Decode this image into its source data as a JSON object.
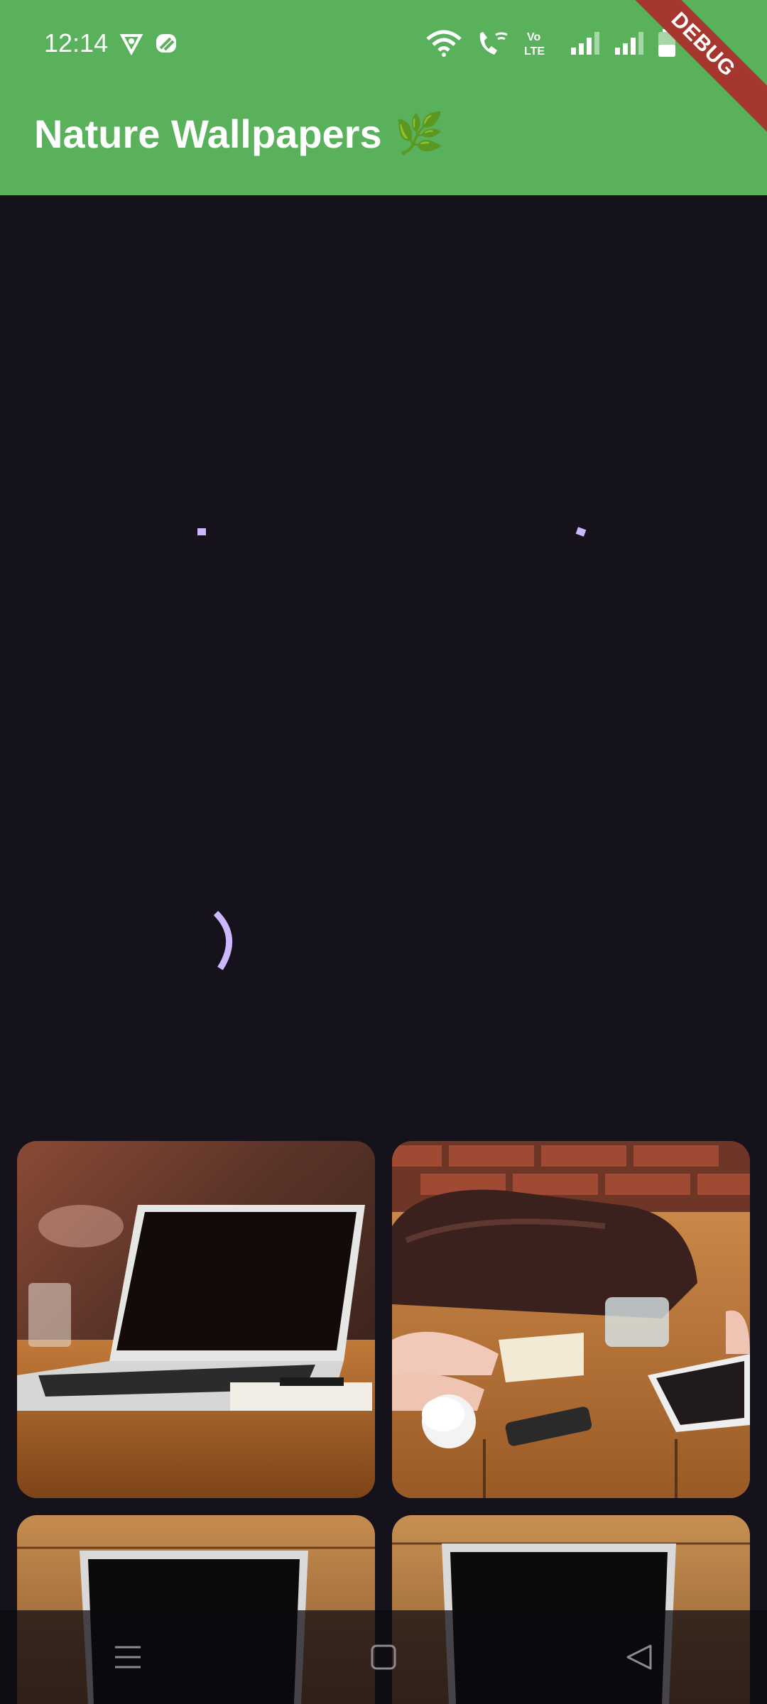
{
  "status_bar": {
    "time": "12:14",
    "battery": "32",
    "icons": [
      "vpn-shield-icon",
      "app-notification-icon",
      "wifi-icon",
      "wifi-call-icon",
      "volte-icon",
      "signal-icon",
      "signal-icon",
      "battery-icon"
    ]
  },
  "app_bar": {
    "title": "Nature Wallpapers",
    "emoji": "🌿"
  },
  "debug_banner": "DEBUG",
  "wallpapers": [
    {
      "name": "laptop-on-wooden-table"
    },
    {
      "name": "meeting-table-with-bag-and-coffee"
    },
    {
      "name": "laptop-on-wood-desk"
    },
    {
      "name": "laptop-on-wood-desk"
    }
  ],
  "nav": {
    "icons": [
      "menu-icon",
      "home-icon",
      "back-icon"
    ]
  },
  "colors": {
    "app_bar": "#59b15c",
    "background": "#16121b",
    "loader": "#cdb7ff"
  }
}
